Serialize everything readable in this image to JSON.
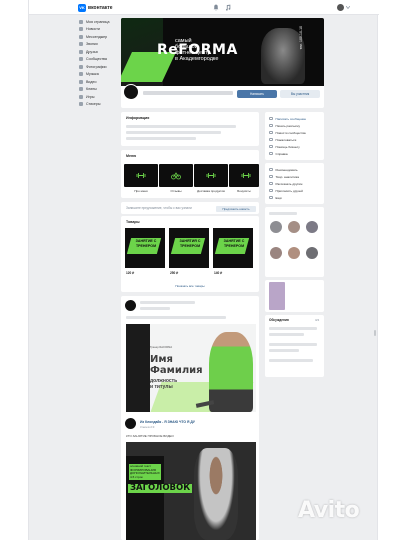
{
  "header": {
    "brand": "вконтакте",
    "logo_letter": "VK"
  },
  "sidebar": {
    "items": [
      {
        "label": "Моя страница",
        "icon": "user-icon"
      },
      {
        "label": "Новости",
        "icon": "news-icon"
      },
      {
        "label": "Мессенджер",
        "icon": "message-icon"
      },
      {
        "label": "Звонки",
        "icon": "phone-icon"
      },
      {
        "label": "Друзья",
        "icon": "friends-icon"
      },
      {
        "label": "Сообщества",
        "icon": "groups-icon"
      },
      {
        "label": "Фотографии",
        "icon": "photo-icon"
      },
      {
        "label": "Музыка",
        "icon": "music-icon"
      },
      {
        "label": "Видео",
        "icon": "video-icon"
      },
      {
        "label": "Клипы",
        "icon": "clips-icon"
      },
      {
        "label": "Игры",
        "icon": "games-icon"
      },
      {
        "label": "Стикеры",
        "icon": "sticker-icon"
      }
    ]
  },
  "cover": {
    "logo": "ReFORMA",
    "line1": "самый",
    "line2": "большой",
    "line3": "фитнес-центр",
    "line4": "в Академгородке",
    "side_text": "тел. 100-10-10"
  },
  "profile": {
    "primary_button": "Написать",
    "secondary_button": "Вы участник"
  },
  "info": {
    "title": "Информация"
  },
  "menu": {
    "title": "Меню",
    "items": [
      {
        "label": "Про меня",
        "icon": "dumbbell-icon"
      },
      {
        "label": "Отзывы",
        "icon": "bike-icon"
      },
      {
        "label": "Доставка продуктов",
        "icon": "dumbbell-icon"
      },
      {
        "label": "Бонуситы",
        "icon": "dumbbell-icon"
      }
    ]
  },
  "post_input": {
    "placeholder": "Запишите предложение, чтобы с вас узнали",
    "button": "Предложить новость"
  },
  "goods": {
    "title": "Товары",
    "items": [
      {
        "title": "ЗАНЯТИЕ С ТРЕНЕРОМ",
        "price": "120 ₽"
      },
      {
        "title": "ЗАНЯТИЯ С ТРЕНЕРОМ",
        "price": "250 ₽"
      },
      {
        "title": "ЗАНЯТИЕ С ТРЕНЕРОМ",
        "price": "140 ₽"
      }
    ],
    "show_all": "Показать все товары"
  },
  "post1": {
    "promo_pre": "Тренер ReFORMA",
    "promo_name_1": "Имя",
    "promo_name_2": "Фамилия",
    "promo_sub_1": "должность",
    "promo_sub_2": "и титулы"
  },
  "post2": {
    "author": "Из Клондайк - Я ЗНАЮ ЧТО Я ДУ",
    "date": "3 мин в 2:0",
    "text": "КТО ЗАНЯТИЕ ПРОБНОЕ ВИДЕО",
    "small_text": "основной текст ФОРМИРОВАНИЯ ДОПОЛНИТЕЛЬНЫХ 4-5 строк",
    "big_text": "ЗАГОЛОВОК"
  },
  "right_column": {
    "actions": [
      {
        "label": "Написать сообщение",
        "icon": "message-icon"
      },
      {
        "label": "Начать рассылку",
        "icon": "mail-icon"
      },
      {
        "label": "Новости сообщества",
        "icon": "news-icon"
      },
      {
        "label": "Пожаловаться",
        "icon": "flag-icon"
      },
      {
        "label": "Помощь бизнесу",
        "icon": "briefcase-icon"
      },
      {
        "label": "Справка",
        "icon": "help-icon"
      }
    ],
    "actions2": [
      {
        "label": "Рекомендовать",
        "icon": "like-icon"
      },
      {
        "label": "Твор. аналитика",
        "icon": "chart-icon"
      },
      {
        "label": "Рассказать другим",
        "icon": "share-icon"
      },
      {
        "label": "Пригласить друзей",
        "icon": "invite-icon"
      },
      {
        "label": "Ещё",
        "icon": "more-icon"
      }
    ],
    "discussions_title": "Обсуждения",
    "discussions_count": "3/4"
  },
  "watermark": "Avito"
}
